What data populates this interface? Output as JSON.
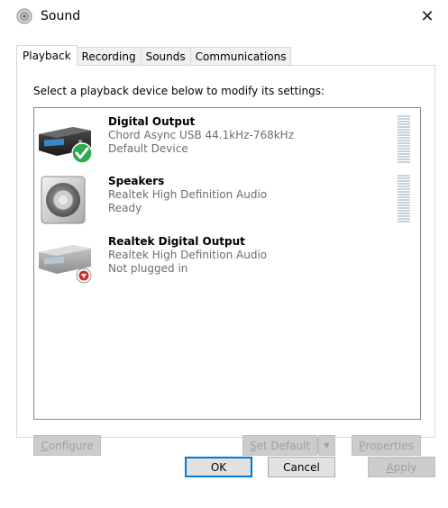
{
  "window": {
    "title": "Sound",
    "close_glyph": "✕",
    "icon": "speaker-icon"
  },
  "tabs": [
    {
      "label": "Playback",
      "active": true
    },
    {
      "label": "Recording",
      "active": false
    },
    {
      "label": "Sounds",
      "active": false
    },
    {
      "label": "Communications",
      "active": false
    }
  ],
  "playback": {
    "instructions": "Select a playback device below to modify its settings:",
    "devices": [
      {
        "name": "Digital Output",
        "line1": "Chord Async USB 44.1kHz-768kHz",
        "line2": "Default Device",
        "icon": "digital-output-icon",
        "badge": "default-check-icon",
        "meter": true
      },
      {
        "name": "Speakers",
        "line1": "Realtek High Definition Audio",
        "line2": "Ready",
        "icon": "speaker-device-icon",
        "badge": "",
        "meter": true
      },
      {
        "name": "Realtek Digital Output",
        "line1": "Realtek High Definition Audio",
        "line2": "Not plugged in",
        "icon": "digital-output-icon",
        "badge": "unplugged-icon",
        "meter": false
      }
    ],
    "buttons": {
      "configure_u": "C",
      "configure_rest": "onfigure",
      "set_default_u": "S",
      "set_default_rest": "et Default",
      "split_arrow": "▼",
      "properties_u": "P",
      "properties_rest": "roperties"
    }
  },
  "footer": {
    "ok": "OK",
    "cancel": "Cancel",
    "apply_u": "A",
    "apply_rest": "pply"
  },
  "colors": {
    "accent": "#0078d7",
    "check_green": "#2fa84f",
    "unplugged_red": "#d0302a"
  }
}
